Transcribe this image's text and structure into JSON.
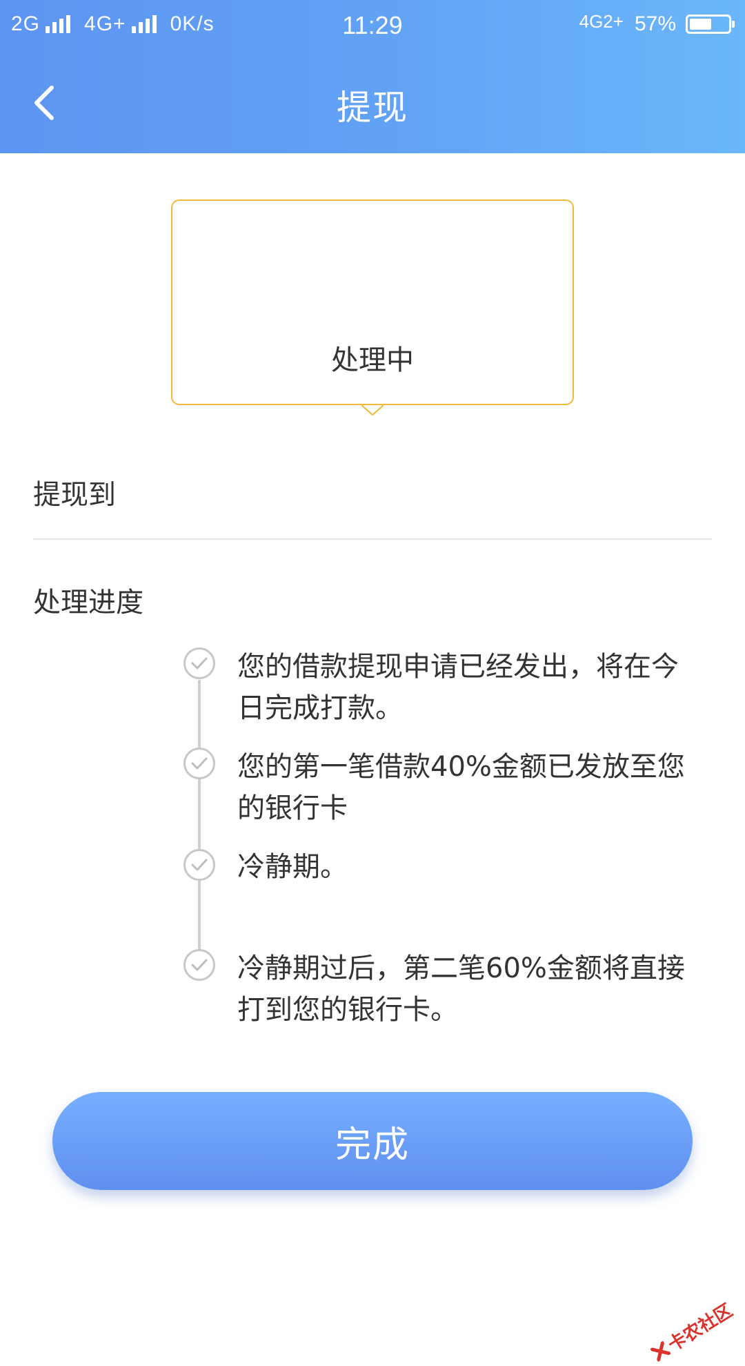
{
  "status_bar": {
    "network1": "2G",
    "network2": "4G+",
    "speed": "0K/s",
    "time": "11:29",
    "network_right": "4G2+",
    "battery": "57%",
    "battery_level": 0.57
  },
  "nav": {
    "title": "提现",
    "back_icon": "chevron-left-icon"
  },
  "status_card": {
    "text": "处理中",
    "border_color": "#f0b93a"
  },
  "withdraw_to": {
    "label": "提现到"
  },
  "progress": {
    "label": "处理进度",
    "steps": [
      {
        "text": "您的借款提现申请已经发出，将在今日完成打款。",
        "icon": "check-circle-icon"
      },
      {
        "text": "您的第一笔借款40%金额已发放至您的银行卡",
        "icon": "check-circle-icon"
      },
      {
        "text": "冷静期。",
        "icon": "check-circle-icon"
      },
      {
        "text": "冷静期过后，第二笔60%金额将直接打到您的银行卡。",
        "icon": "check-circle-icon"
      }
    ]
  },
  "done_button": {
    "label": "完成"
  },
  "watermark": {
    "text": "卡农社区"
  },
  "colors": {
    "header_gradient_start": "#5d94f2",
    "header_gradient_end": "#6bb7fb",
    "button_gradient_start": "#77afff",
    "button_gradient_end": "#5f8ff0",
    "watermark": "#d8332c"
  }
}
